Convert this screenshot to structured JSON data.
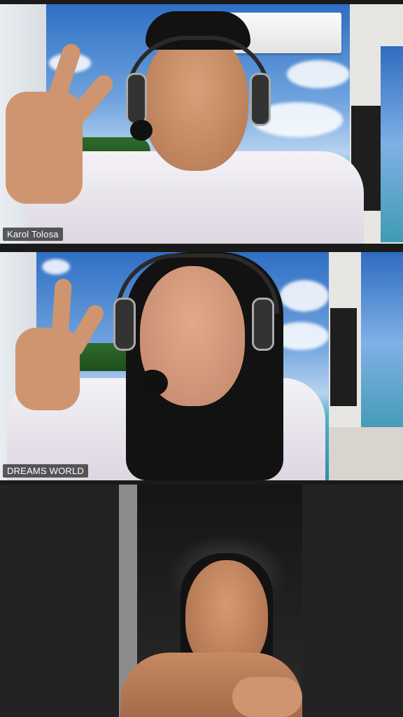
{
  "participants": [
    {
      "name": "Karol Tolosa"
    },
    {
      "name": "DREAMS WORLD"
    },
    {
      "name": ""
    }
  ]
}
